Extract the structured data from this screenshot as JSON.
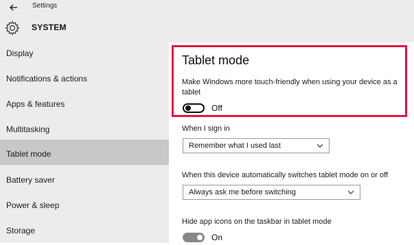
{
  "window": {
    "title": "Settings"
  },
  "header": {
    "section": "SYSTEM"
  },
  "sidebar": {
    "items": [
      {
        "label": "Display"
      },
      {
        "label": "Notifications & actions"
      },
      {
        "label": "Apps & features"
      },
      {
        "label": "Multitasking"
      },
      {
        "label": "Tablet mode"
      },
      {
        "label": "Battery saver"
      },
      {
        "label": "Power & sleep"
      },
      {
        "label": "Storage"
      }
    ],
    "active": "Tablet mode"
  },
  "main": {
    "title": "Tablet mode",
    "description": "Make Windows more touch-friendly when using your device as a tablet",
    "tablet_toggle": {
      "state": "Off"
    },
    "signin": {
      "label": "When I sign in",
      "selected": "Remember what I used last"
    },
    "auto_switch": {
      "label": "When this device automatically switches tablet mode on or off",
      "selected": "Always ask me before switching"
    },
    "hide_icons": {
      "label": "Hide app icons on the taskbar in tablet mode",
      "state": "On"
    }
  },
  "colors": {
    "highlight": "#e3133f",
    "sidebar_bg": "#ececec",
    "active_item": "#c8c8c8"
  },
  "icons": [
    "back-arrow-icon",
    "gear-icon",
    "chevron-down-icon"
  ]
}
